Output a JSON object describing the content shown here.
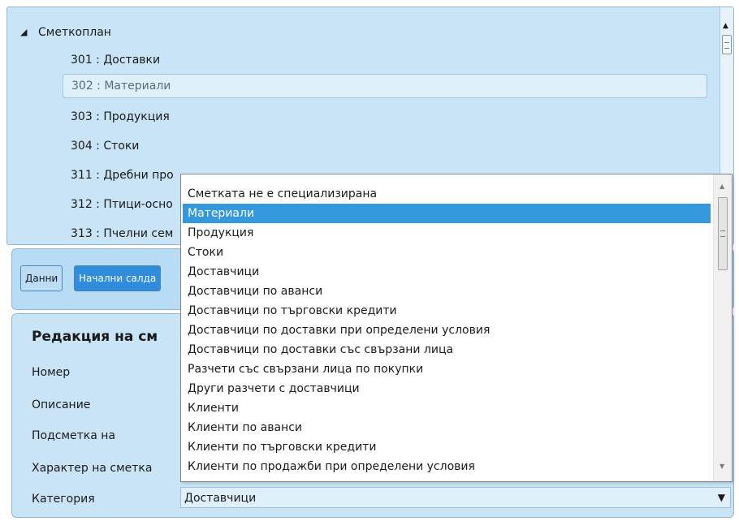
{
  "tree": {
    "root_label": "Сметкоплан",
    "items": [
      {
        "label": "301 : Доставки"
      },
      {
        "label": "302 : Материали"
      },
      {
        "label": "303 : Продукция"
      },
      {
        "label": "304 : Стоки"
      },
      {
        "label": "311 : Дребни про"
      },
      {
        "label": "312 : Птици-осно"
      },
      {
        "label": "313 : Пчелни сем"
      }
    ],
    "selected_index": 1
  },
  "tabs": {
    "data": "Данни",
    "initial_balances": "Начални салда"
  },
  "form": {
    "title": "Редакция на см",
    "fields": {
      "number": "Номер",
      "description": "Описание",
      "subaccount_of": "Подсметка на",
      "account_character": "Характер на сметка",
      "category": "Категория"
    },
    "category_value": "Доставчици"
  },
  "dropdown": {
    "items": [
      "Сметката не е специализирана",
      "Материали",
      "Продукция",
      "Стоки",
      "Доставчици",
      "Доставчици по аванси",
      "Доставчици по търговски кредити",
      "Доставчици по доставки при определени условия",
      "Доставчици по доставки със свързани лица",
      "Разчети със свързани лица по покупки",
      "Други разчети с доставчици",
      "Клиенти",
      "Клиенти по аванси",
      "Клиенти по търговски кредити",
      "Клиенти по продажби при определени условия"
    ],
    "highlighted_index": 1
  },
  "icons": {
    "tree_expand": "expanded-triangle-icon",
    "combo_arrow": "dropdown-arrow-icon"
  },
  "colors": {
    "panel_bg": "#c9e4f6",
    "highlight": "#3399dc",
    "tab_active": "#2f8ddb"
  }
}
